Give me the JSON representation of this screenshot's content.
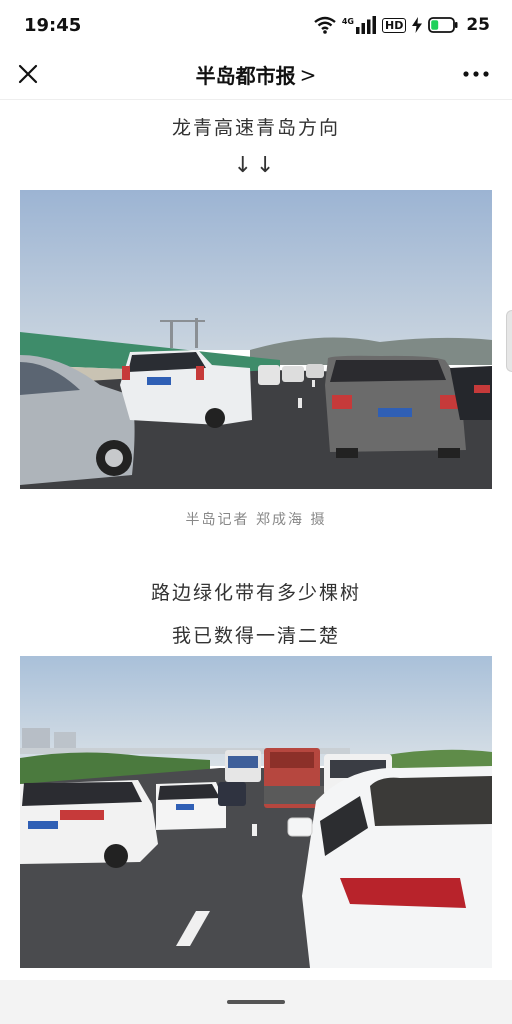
{
  "status_bar": {
    "time": "19:45",
    "network_label": "4G",
    "hd_label": "HD",
    "battery": "25",
    "icons": [
      "wifi-icon",
      "signal-icon",
      "hd-icon",
      "charging-icon",
      "battery-icon"
    ]
  },
  "nav": {
    "title": "半岛都市报",
    "title_chevron": ">",
    "close_icon": "close-icon",
    "more_icon": "more-icon"
  },
  "article": {
    "heading_1": "龙青高速青岛方向",
    "arrows": "↓↓",
    "photo_1_caption": "半岛记者 郑成海 摄",
    "line_2": "路边绿化带有多少棵树",
    "line_3": "我已数得一清二楚"
  },
  "colors": {
    "sky": "#9db6d2",
    "road": "#3e3f41",
    "accent_text": "#333333",
    "caption_text": "#888888"
  }
}
